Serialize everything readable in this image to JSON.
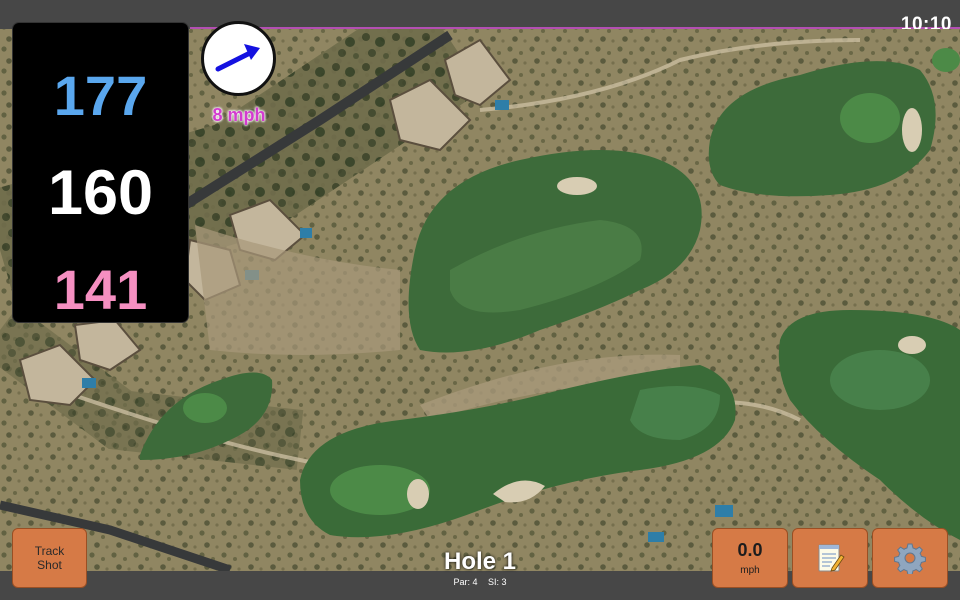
{
  "status": {
    "time": "10:10"
  },
  "distances": {
    "back": "177",
    "middle": "160",
    "front": "141"
  },
  "wind": {
    "label": "8 mph",
    "direction_icon": "arrow-icon"
  },
  "buttons": {
    "track_shot": [
      "Track",
      "Shot"
    ],
    "wind_speed_value": "0.0",
    "wind_speed_unit": "mph",
    "notes_icon": "notepad-icon",
    "settings_icon": "gear-icon"
  },
  "hole": {
    "title": "Hole 1",
    "par": "Par: 4",
    "si": "SI: 3"
  },
  "colors": {
    "back": "#5aa7ee",
    "middle": "#ffffff",
    "front": "#f58fc1",
    "wind_text": "#d33ccf",
    "button": "#d67a46",
    "accent_line": "#b34fb2"
  }
}
